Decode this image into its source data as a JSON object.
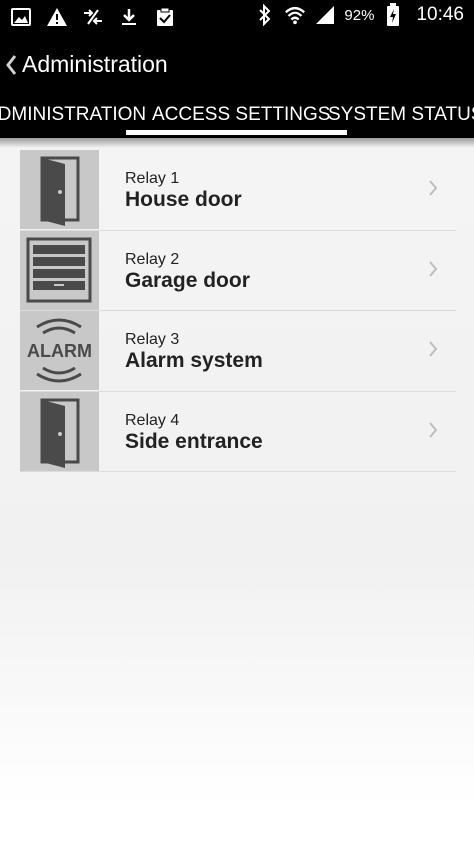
{
  "status_bar": {
    "battery_percent": "92%",
    "time": "10:46",
    "icons": [
      "image-icon",
      "alert-icon",
      "data-transfer-icon",
      "download-icon",
      "clipboard-check-icon",
      "bluetooth-icon",
      "wifi-icon",
      "signal-icon",
      "battery-charging-icon"
    ]
  },
  "app_bar": {
    "title": "Administration",
    "back_icon": "chevron-left-icon"
  },
  "tabs": [
    {
      "label": "ADMINISTRATION",
      "selected": false
    },
    {
      "label": "ACCESS SETTINGS",
      "selected": true
    },
    {
      "label": "SYSTEM STATUS",
      "selected": false
    }
  ],
  "relays": [
    {
      "subtitle": "Relay 1",
      "title": "House door",
      "icon": "door-icon"
    },
    {
      "subtitle": "Relay 2",
      "title": "Garage door",
      "icon": "garage-door-icon"
    },
    {
      "subtitle": "Relay 3",
      "title": "Alarm system",
      "icon": "alarm-icon",
      "icon_text": "ALARM"
    },
    {
      "subtitle": "Relay 4",
      "title": "Side entrance",
      "icon": "door-icon"
    }
  ],
  "colors": {
    "bar_background": "#000000",
    "thumb_background": "#c8c8c8",
    "icon_gray": "#4a4a4a"
  }
}
